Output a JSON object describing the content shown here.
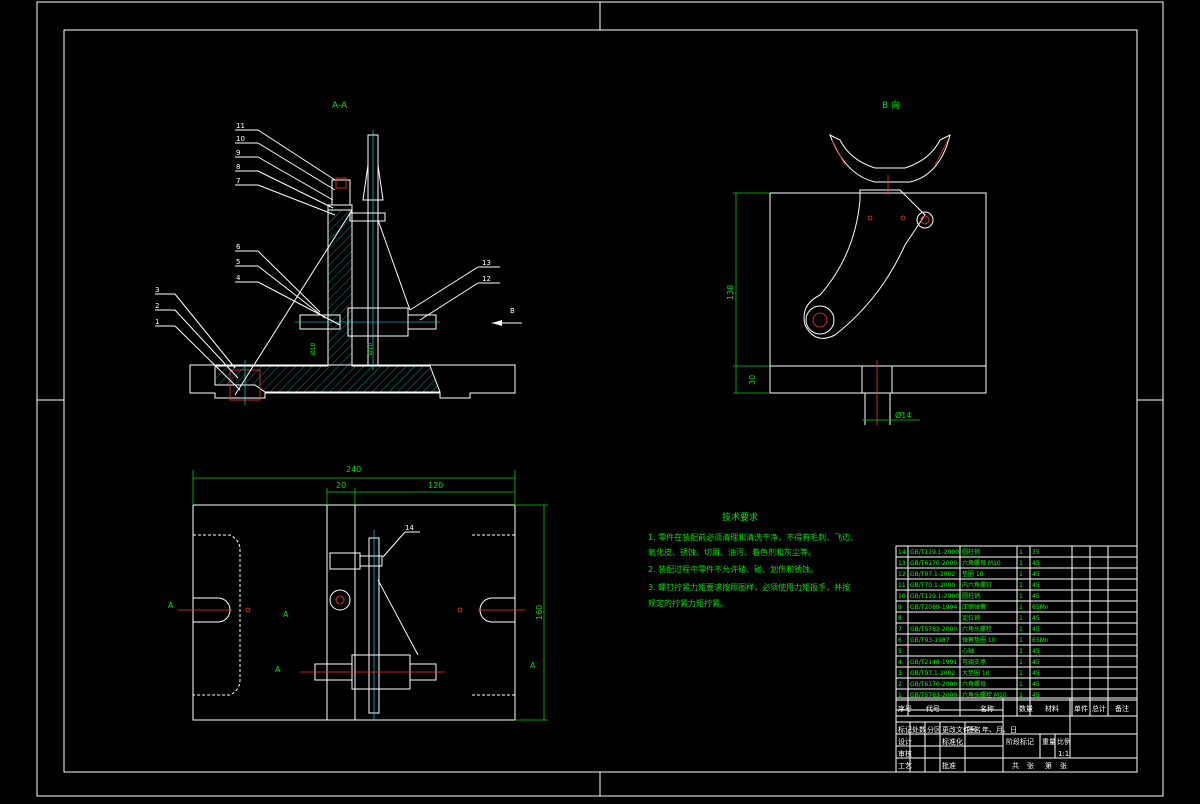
{
  "views": {
    "section_label": "A-A",
    "direction_label": "B 向",
    "arrow_b": "B",
    "section_marks": [
      "A",
      "A",
      "A",
      "A"
    ]
  },
  "callouts": [
    "11",
    "10",
    "9",
    "8",
    "7",
    "6",
    "5",
    "4",
    "3",
    "2",
    "1",
    "13",
    "12",
    "14"
  ],
  "dimensions": {
    "plan_total": "240",
    "plan_left": "20",
    "plan_right": "120",
    "plan_height": "160",
    "side_height": "138",
    "side_base": "30",
    "side_hole": "Ø14",
    "fit_1": "Ø10",
    "fit_2": "Ø10"
  },
  "tech_requirements": {
    "title": "技术要求",
    "items": [
      "1. 零件在装配前必须清理和清洗干净，不得有毛刺、飞边、",
      "氧化皮、锈蚀、切屑、油污、着色剂和灰尘等。",
      "2. 装配过程中零件不允许磕、碰、划伤和锈蚀。",
      "3. 螺钉拧紧力矩要求按照图样，必须使用力矩扳手，并按",
      "规定的拧紧力矩拧紧。"
    ]
  },
  "bom": {
    "rows": [
      [
        "14",
        "GB/T119.1-2000",
        "圆柱销",
        "1",
        "35"
      ],
      [
        "13",
        "GB/T6170-2000",
        "六角螺母 M10",
        "1",
        "45"
      ],
      [
        "12",
        "GB/T97.1-2002",
        "垫圈 10",
        "1",
        "45"
      ],
      [
        "11",
        "GB/T70.1-2000",
        "内六角螺钉",
        "1",
        "45"
      ],
      [
        "10",
        "GB/T119.1-2000",
        "圆柱销",
        "1",
        "45"
      ],
      [
        "9",
        "GB/T2089-1994",
        "压缩弹簧",
        "1",
        "65Mn"
      ],
      [
        "8",
        "",
        "定位销",
        "1",
        "45"
      ],
      [
        "7",
        "GB/T5783-2000",
        "六角头螺栓",
        "1",
        "45"
      ],
      [
        "6",
        "GB/T93-1987",
        "弹簧垫圈 10",
        "1",
        "65Mn"
      ],
      [
        "5",
        "",
        "心轴",
        "1",
        "45"
      ],
      [
        "4",
        "GB/T2148-1991",
        "可调支承",
        "1",
        "45"
      ],
      [
        "3",
        "GB/T97.1-2002",
        "大垫圈 10",
        "1",
        "45"
      ],
      [
        "2",
        "GB/T6170-2000",
        "六角螺母",
        "1",
        "45"
      ],
      [
        "1",
        "GB/T5783-2000",
        "六角头螺栓 M10",
        "1",
        "45"
      ]
    ],
    "header": [
      "序号",
      "代号",
      "名称",
      "数量",
      "材料",
      "单件",
      "总计",
      "备注"
    ]
  },
  "title_block": {
    "row1": [
      "标记",
      "处数",
      "分区",
      "更改文件号",
      "签名",
      "年、月、日"
    ],
    "row2": [
      "设计",
      "标准化"
    ],
    "row3": [
      "审核"
    ],
    "row4": [
      "工艺",
      "批准"
    ],
    "stage": [
      "阶段标记",
      "重量",
      "比例"
    ],
    "scale": "1:1",
    "sheets": [
      "共",
      "张",
      "第",
      "张"
    ]
  }
}
